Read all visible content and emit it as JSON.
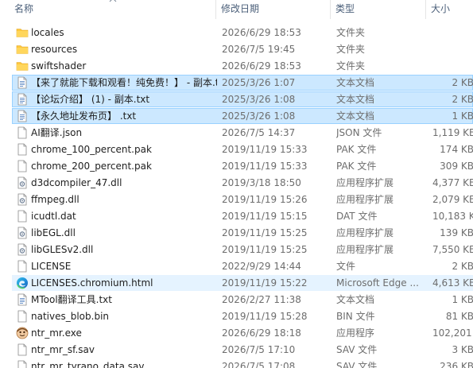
{
  "header": {
    "name_label": "名称",
    "date_label": "修改日期",
    "type_label": "类型",
    "size_label": "大小"
  },
  "colors": {
    "selection_bg": "#cce8ff",
    "selection_border": "#99d1ff",
    "hover_bg": "#e5f3ff",
    "folder": "#ffc83d",
    "header_text": "#4c607a"
  },
  "files": [
    {
      "name": "locales",
      "date": "2026/6/29 18:53",
      "type": "文件夹",
      "size": "",
      "icon": "folder-icon",
      "state": ""
    },
    {
      "name": "resources",
      "date": "2026/7/5 19:45",
      "type": "文件夹",
      "size": "",
      "icon": "folder-icon",
      "state": ""
    },
    {
      "name": "swiftshader",
      "date": "2026/6/29 18:53",
      "type": "文件夹",
      "size": "",
      "icon": "folder-icon",
      "state": ""
    },
    {
      "name": "【来了就能下载和观看！纯免费！】 - 副本.txt",
      "date": "2025/3/26 1:07",
      "type": "文本文档",
      "size": "2 KB",
      "icon": "text-file-icon",
      "state": "selected"
    },
    {
      "name": "【论坛介绍】 (1) - 副本.txt",
      "date": "2025/3/26 1:08",
      "type": "文本文档",
      "size": "2 KB",
      "icon": "text-file-icon",
      "state": "selected"
    },
    {
      "name": "【永久地址发布页】 .txt",
      "date": "2025/3/26 1:08",
      "type": "文本文档",
      "size": "1 KB",
      "icon": "text-file-icon",
      "state": "selected"
    },
    {
      "name": "AI翻译.json",
      "date": "2026/7/5 14:37",
      "type": "JSON 文件",
      "size": "1,119 KB",
      "icon": "file-icon",
      "state": ""
    },
    {
      "name": "chrome_100_percent.pak",
      "date": "2019/11/19 15:33",
      "type": "PAK 文件",
      "size": "174 KB",
      "icon": "file-icon",
      "state": ""
    },
    {
      "name": "chrome_200_percent.pak",
      "date": "2019/11/19 15:33",
      "type": "PAK 文件",
      "size": "309 KB",
      "icon": "file-icon",
      "state": ""
    },
    {
      "name": "d3dcompiler_47.dll",
      "date": "2019/3/18 18:50",
      "type": "应用程序扩展",
      "size": "4,377 KB",
      "icon": "dll-file-icon",
      "state": ""
    },
    {
      "name": "ffmpeg.dll",
      "date": "2019/11/19 15:26",
      "type": "应用程序扩展",
      "size": "2,079 KB",
      "icon": "dll-file-icon",
      "state": ""
    },
    {
      "name": "icudtl.dat",
      "date": "2019/11/19 15:15",
      "type": "DAT 文件",
      "size": "10,183 KB",
      "icon": "file-icon",
      "state": ""
    },
    {
      "name": "libEGL.dll",
      "date": "2019/11/19 15:25",
      "type": "应用程序扩展",
      "size": "139 KB",
      "icon": "dll-file-icon",
      "state": ""
    },
    {
      "name": "libGLESv2.dll",
      "date": "2019/11/19 15:25",
      "type": "应用程序扩展",
      "size": "7,550 KB",
      "icon": "dll-file-icon",
      "state": ""
    },
    {
      "name": "LICENSE",
      "date": "2022/9/29 14:44",
      "type": "文件",
      "size": "2 KB",
      "icon": "file-icon",
      "state": ""
    },
    {
      "name": "LICENSES.chromium.html",
      "date": "2019/11/19 15:22",
      "type": "Microsoft Edge ...",
      "size": "4,613 KB",
      "icon": "edge-icon",
      "state": "hover"
    },
    {
      "name": "MTool翻译工具.txt",
      "date": "2026/2/27 11:38",
      "type": "文本文档",
      "size": "1 KB",
      "icon": "text-file-icon",
      "state": ""
    },
    {
      "name": "natives_blob.bin",
      "date": "2019/11/19 15:28",
      "type": "BIN 文件",
      "size": "81 KB",
      "icon": "file-icon",
      "state": ""
    },
    {
      "name": "ntr_mr.exe",
      "date": "2026/6/29 18:18",
      "type": "应用程序",
      "size": "102,201 KB",
      "icon": "app-exe-icon",
      "state": ""
    },
    {
      "name": "ntr_mr_sf.sav",
      "date": "2026/7/5 17:10",
      "type": "SAV 文件",
      "size": "3 KB",
      "icon": "file-icon",
      "state": ""
    },
    {
      "name": "ntr_mr_tyrano_data.sav",
      "date": "2026/7/5 17:08",
      "type": "SAV 文件",
      "size": "236 KB",
      "icon": "file-icon",
      "state": ""
    }
  ]
}
